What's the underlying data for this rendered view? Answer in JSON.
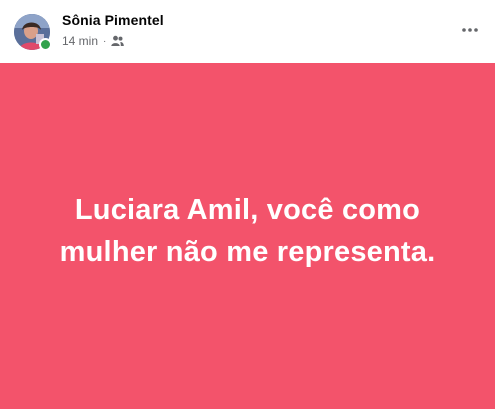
{
  "post": {
    "author": "Sônia Pimentel",
    "timestamp": "14 min",
    "separator": "·",
    "audience_icon": "friends-icon",
    "more_icon": "more-options-icon",
    "text": "Luciara Amil, você como mulher não me representa.",
    "background_color": "#f3536b",
    "text_color": "#ffffff"
  }
}
